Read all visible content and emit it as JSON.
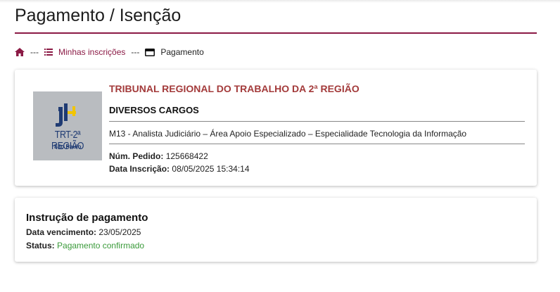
{
  "page": {
    "title": "Pagamento / Isenção"
  },
  "breadcrumb": {
    "separator": "---",
    "home_icon": "home-icon",
    "inscricoes_icon": "list-icon",
    "inscricoes_label": "Minhas inscrições",
    "pagamento_icon": "payment-card-icon",
    "pagamento_label": "Pagamento"
  },
  "colors": {
    "accent": "#8b1a45",
    "org_name": "#a33a3a",
    "status_ok": "#3a9a3a",
    "logo_bg": "#b9bcc0",
    "logo_text": "#1f3b73",
    "logo_yellow": "#f2c500"
  },
  "inscription": {
    "logo": {
      "title": "TRT-2ª REGIÃO",
      "subtitle": "São Paulo"
    },
    "org_name": "TRIBUNAL REGIONAL DO TRABALHO DA 2ª REGIÃO",
    "cargo": "DIVERSOS CARGOS",
    "position": "M13 - Analista Judiciário – Área Apoio Especializado – Especialidade Tecnologia da Informação",
    "pedido_label": "Núm. Pedido:",
    "pedido_value": "125668422",
    "data_label": "Data Inscrição:",
    "data_value": "08/05/2025 15:34:14"
  },
  "payment": {
    "title": "Instrução de pagamento",
    "vencimento_label": "Data vencimento:",
    "vencimento_value": "23/05/2025",
    "status_label": "Status:",
    "status_value": "Pagamento confirmado"
  }
}
